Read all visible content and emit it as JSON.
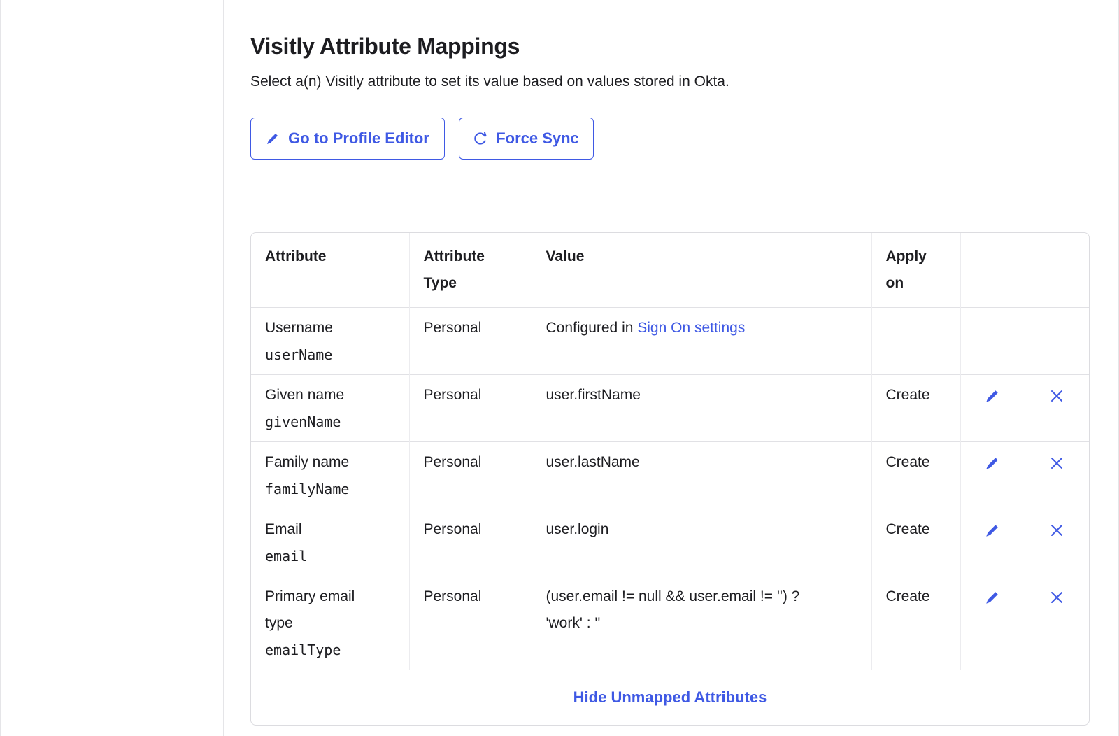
{
  "header": {
    "title": "Visitly Attribute Mappings",
    "subtitle": "Select a(n) Visitly attribute to set its value based on values stored in Okta."
  },
  "toolbar": {
    "profile_editor_label": "Go to Profile Editor",
    "profile_editor_icon": "pencil-icon",
    "force_sync_label": "Force Sync",
    "force_sync_icon": "refresh-icon"
  },
  "colors": {
    "accent": "#3f59e4",
    "text": "#1d1d21",
    "border": "#dcdce0"
  },
  "table": {
    "headers": {
      "attribute": "Attribute",
      "attribute_type_line1": "Attribute",
      "attribute_type_line2": "Type",
      "value": "Value",
      "apply_on_line1": "Apply",
      "apply_on_line2": "on"
    },
    "rows": [
      {
        "label": "Username",
        "var": "userName",
        "type": "Personal",
        "value_prefix": "Configured in ",
        "value_link": "Sign On settings",
        "apply_on": ""
      },
      {
        "label": "Given name",
        "var": "givenName",
        "type": "Personal",
        "value": "user.firstName",
        "apply_on": "Create"
      },
      {
        "label": "Family name",
        "var": "familyName",
        "type": "Personal",
        "value": "user.lastName",
        "apply_on": "Create"
      },
      {
        "label": "Email",
        "var": "email",
        "type": "Personal",
        "value": "user.login",
        "apply_on": "Create"
      },
      {
        "label_line1": "Primary email",
        "label_line2": "type",
        "var": "emailType",
        "type": "Personal",
        "value_line1": "(user.email != null && user.email != '') ?",
        "value_line2": "'work' : ''",
        "apply_on": "Create"
      }
    ],
    "row_action_icons": [
      "pencil-icon",
      "close-icon"
    ],
    "footer_link": "Hide Unmapped Attributes"
  }
}
